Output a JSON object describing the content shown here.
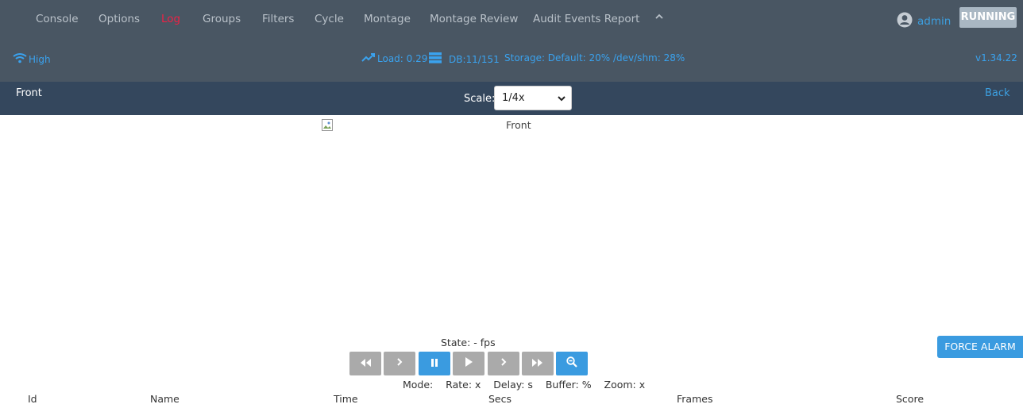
{
  "nav": {
    "items": [
      {
        "label": "Console",
        "active": false
      },
      {
        "label": "Options",
        "active": false
      },
      {
        "label": "Log",
        "active": true
      },
      {
        "label": "Groups",
        "active": false
      },
      {
        "label": "Filters",
        "active": false
      },
      {
        "label": "Cycle",
        "active": false
      },
      {
        "label": "Montage",
        "active": false
      },
      {
        "label": "Montage Review",
        "active": false
      },
      {
        "label": "Audit Events Report",
        "active": false
      }
    ],
    "collapse_icon": "chevron-up-icon",
    "user": {
      "icon": "user-circle-icon",
      "name": "admin"
    },
    "status_button": "RUNNING"
  },
  "status": {
    "bandwidth": {
      "icon": "wifi-icon",
      "label": "High"
    },
    "load": {
      "icon": "trending-up-icon",
      "label": "Load: 0.29"
    },
    "db": {
      "icon": "database-icon",
      "label": "DB:11/151"
    },
    "storage": "Storage: Default: 20% /dev/shm: 28%",
    "version": "v1.34.22"
  },
  "monitor": {
    "name": "Front",
    "scale_label": "Scale:",
    "scale_value": "1/4x",
    "back_label": "Back",
    "image_alt": "Front"
  },
  "player": {
    "state_line": "State:  -  fps",
    "buttons": [
      {
        "name": "fast-rewind-button",
        "icon": "fast-rewind-icon",
        "active": false
      },
      {
        "name": "slow-rewind-button",
        "icon": "chevron-right-icon",
        "active": false
      },
      {
        "name": "pause-button",
        "icon": "pause-icon",
        "active": true
      },
      {
        "name": "play-button",
        "icon": "play-icon",
        "active": false
      },
      {
        "name": "slow-forward-button",
        "icon": "chevron-right-icon",
        "active": false
      },
      {
        "name": "fast-forward-button",
        "icon": "fast-forward-icon",
        "active": false
      },
      {
        "name": "zoom-out-button",
        "icon": "zoom-out-icon",
        "active": true
      }
    ],
    "mode_line": "Mode:    Rate: x    Delay: s    Buffer: %    Zoom: x",
    "force_alarm": "FORCE ALARM"
  },
  "events_table": {
    "columns": [
      "Id",
      "Name",
      "Time",
      "Secs",
      "Frames",
      "Score"
    ]
  },
  "colors": {
    "nav_bg": "#495663",
    "titlebar_bg": "#34475d",
    "accent": "#3a9be0",
    "active_nav": "#f02045",
    "button_grey": "#aaaaaa"
  }
}
